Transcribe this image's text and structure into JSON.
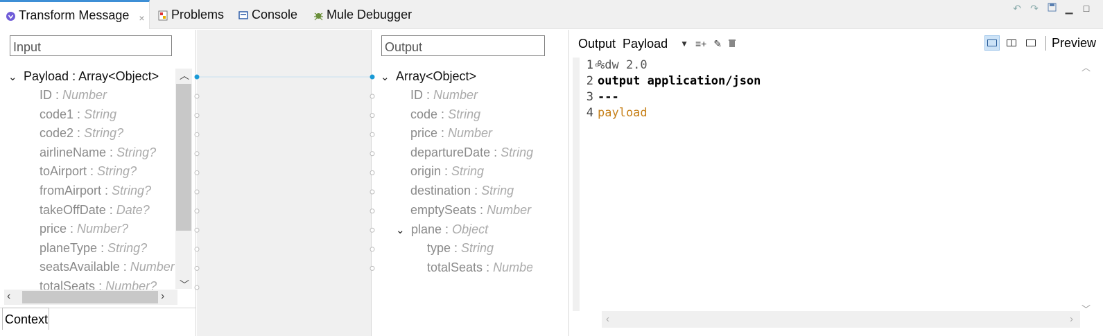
{
  "tabs": [
    {
      "label": "Transform Message",
      "icon": "dataweave-icon",
      "active": true,
      "close": "×"
    },
    {
      "label": "Problems",
      "icon": "problems-icon",
      "active": false
    },
    {
      "label": "Console",
      "icon": "console-icon",
      "active": false
    },
    {
      "label": "Mule Debugger",
      "icon": "debugger-icon",
      "active": false
    }
  ],
  "input": {
    "placeholder": "Input",
    "root": {
      "name": "Payload",
      "sep": " : ",
      "type": "Array<Object>"
    },
    "fields": [
      {
        "name": "ID",
        "type": "Number"
      },
      {
        "name": "code1",
        "type": "String"
      },
      {
        "name": "code2",
        "type": "String?"
      },
      {
        "name": "airlineName",
        "type": "String?"
      },
      {
        "name": "toAirport",
        "type": "String?"
      },
      {
        "name": "fromAirport",
        "type": "String?"
      },
      {
        "name": "takeOffDate",
        "type": "Date?"
      },
      {
        "name": "price",
        "type": "Number?"
      },
      {
        "name": "planeType",
        "type": "String?"
      },
      {
        "name": "seatsAvailable",
        "type": "Number?"
      },
      {
        "name": "totalSeats",
        "type": "Number?"
      }
    ],
    "context_tab": "Context"
  },
  "output": {
    "placeholder": "Output",
    "root": {
      "type": "Array<Object>"
    },
    "fields": [
      {
        "name": "ID",
        "type": "Number"
      },
      {
        "name": "code",
        "type": "String"
      },
      {
        "name": "price",
        "type": "Number"
      },
      {
        "name": "departureDate",
        "type": "String"
      },
      {
        "name": "origin",
        "type": "String"
      },
      {
        "name": "destination",
        "type": "String"
      },
      {
        "name": "emptySeats",
        "type": "Number"
      }
    ],
    "plane": {
      "name": "plane",
      "type": "Object",
      "children": [
        {
          "name": "type",
          "type": "String"
        },
        {
          "name": "totalSeats",
          "type": "Number"
        }
      ]
    }
  },
  "editor": {
    "output_label": "Output",
    "target": "Payload",
    "preview": "Preview",
    "lines": [
      {
        "n": "1",
        "text": "%dw 2.0"
      },
      {
        "n": "2",
        "text": "output application/json"
      },
      {
        "n": "3",
        "text": "---"
      },
      {
        "n": "4",
        "text": "payload"
      }
    ]
  },
  "colors": {
    "accent": "#3d8fd6",
    "connector": "#1a9ad6",
    "keyword_payload": "#c7811a"
  }
}
